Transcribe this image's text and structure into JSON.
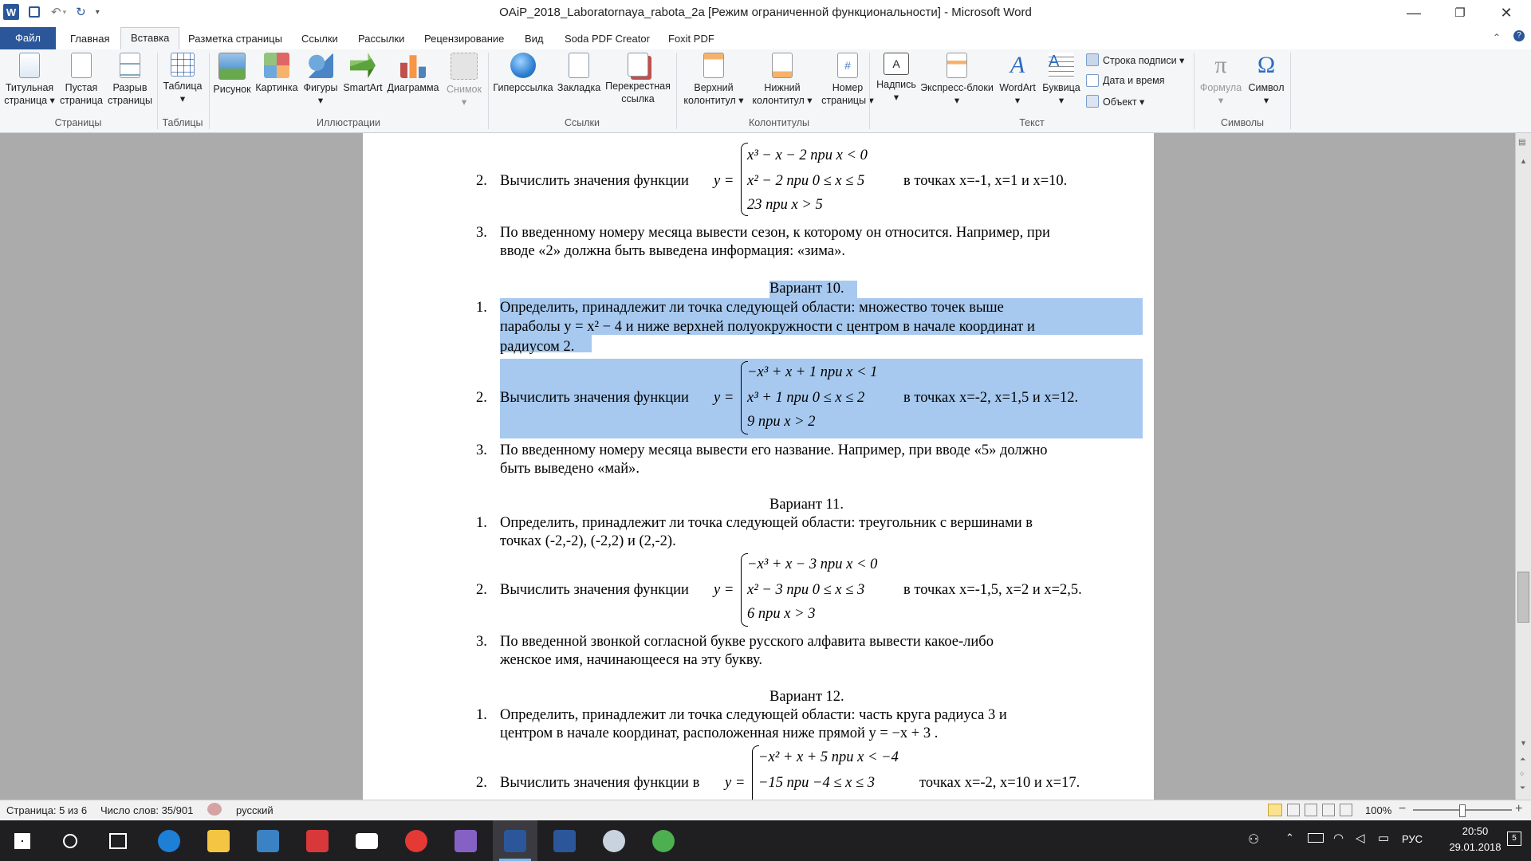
{
  "window": {
    "title": "OAiP_2018_Laboratornaya_rabota_2a [Режим ограниченной функциональности]  -  Microsoft Word",
    "app_icon_letter": "W",
    "minimize_glyph": "—",
    "restore_glyph": "❐",
    "close_glyph": "✕"
  },
  "tabs": [
    {
      "label": "Файл"
    },
    {
      "label": "Главная"
    },
    {
      "label": "Вставка"
    },
    {
      "label": "Разметка страницы"
    },
    {
      "label": "Ссылки"
    },
    {
      "label": "Рассылки"
    },
    {
      "label": "Рецензирование"
    },
    {
      "label": "Вид"
    },
    {
      "label": "Soda PDF Creator"
    },
    {
      "label": "Foxit PDF"
    }
  ],
  "ribbon": {
    "buttons": {
      "title_page": [
        "Титульная",
        "страница ▾"
      ],
      "blank_page": [
        "Пустая",
        "страница"
      ],
      "page_break": [
        "Разрыв",
        "страницы"
      ],
      "table": [
        "Таблица",
        "▾"
      ],
      "picture": [
        "Рисунок"
      ],
      "clipart": [
        "Картинка"
      ],
      "shapes": [
        "Фигуры",
        "▾"
      ],
      "smartart": [
        "SmartArt"
      ],
      "chart": [
        "Диаграмма"
      ],
      "screenshot": [
        "Снимок",
        "▾"
      ],
      "hyperlink": [
        "Гиперссылка"
      ],
      "bookmark": [
        "Закладка"
      ],
      "crossref": [
        "Перекрестная",
        "ссылка"
      ],
      "header": [
        "Верхний",
        "колонтитул ▾"
      ],
      "footer": [
        "Нижний",
        "колонтитул ▾"
      ],
      "page_number": [
        "Номер",
        "страницы ▾"
      ],
      "textbox": [
        "Надпись",
        "▾"
      ],
      "quickparts": [
        "Экспресс-блоки",
        "▾"
      ],
      "wordart": [
        "WordArt",
        "▾"
      ],
      "dropcap": [
        "Буквица",
        "▾"
      ],
      "equation": [
        "Формула",
        "▾"
      ],
      "symbol": [
        "Символ",
        "▾"
      ]
    },
    "small": {
      "signature": "Строка подписи  ▾",
      "datetime": "Дата и время",
      "object": "Объект  ▾"
    },
    "groups": [
      "Страницы",
      "Таблицы",
      "Иллюстрации",
      "Ссылки",
      "Колонтитулы",
      "Текст",
      "Символы"
    ]
  },
  "document": {
    "v9": {
      "item2_prefix": "Вычислить значения функции",
      "item2_rows": [
        "x³ − x − 2   при  x < 0",
        "x²  − 2     при  0 ≤ x ≤ 5",
        "23        при  x > 5"
      ],
      "item2_suffix": "в точках x=-1, x=1 и x=10.",
      "item3_line1": "По введенному номеру месяца вывести сезон, к которому он относится. Например, при",
      "item3_line2": "вводе «2» должна быть выведена информация: «зима»."
    },
    "v10": {
      "heading": "Вариант 10.",
      "item1_line1": "Определить,  принадлежит  ли  точка  следующей  области:  множество  точек  выше",
      "item1_line2": "параболы  y = x² − 4 и  ниже  верхней  полуокружности  с  центром  в  начале  координат  и",
      "item1_line3": "радиусом 2.",
      "item2_prefix": "Вычислить значения функции",
      "item2_rows": [
        "−x³ + x + 1   при  x < 1",
        "x³ + 1        при  0 ≤ x ≤ 2",
        "9        при  x > 2"
      ],
      "item2_suffix": "в точках x=-2, x=1,5 и x=12.",
      "item3_line1": "По введенному номеру месяца вывести его название. Например, при вводе «5» должно",
      "item3_line2": "быть выведено «май»."
    },
    "v11": {
      "heading": "Вариант 11.",
      "item1_line1": "Определить,  принадлежит  ли  точка  следующей  области:  треугольник  с  вершинами  в",
      "item1_line2": "точках (-2,-2), (-2,2) и (2,-2).",
      "item2_prefix": "Вычислить значения функции",
      "item2_rows": [
        "−x³ + x − 3   при  x < 0",
        "x² − 3        при  0 ≤ x ≤ 3",
        "6        при  x > 3"
      ],
      "item2_suffix": "в точках x=-1,5, x=2 и x=2,5.",
      "item3_line1": "По  введенной  звонкой  согласной  букве  русского  алфавита  вывести  какое-либо",
      "item3_line2": "женское имя, начинающееся на эту букву."
    },
    "v12": {
      "heading": "Вариант 12.",
      "item1_line1": "Определить,  принадлежит  ли  точка  следующей  области:  часть  круга  радиуса  3  и",
      "item1_line2": "центром в начале координат, расположенная ниже прямой  y = −x + 3 .",
      "item2_prefix": "Вычислить значения функции в",
      "item2_rows": [
        "−x² + x + 5   при  x < −4",
        "−15        при  −4 ≤ x ≤ 3"
      ],
      "item2_suffix": "точках x=-2, x=10 и x=17."
    },
    "numbers": {
      "n1": "1.",
      "n2": "2.",
      "n3": "3."
    },
    "y_eq": "y ="
  },
  "status": {
    "page": "Страница: 5 из 6",
    "words": "Число слов: 35/901",
    "lang": "русский",
    "zoom": "100%",
    "zoom_minus": "−",
    "zoom_plus": "+"
  },
  "taskbar": {
    "lang": "РУС",
    "time": "20:50",
    "date": "29.01.2018",
    "notif_count": "5"
  }
}
